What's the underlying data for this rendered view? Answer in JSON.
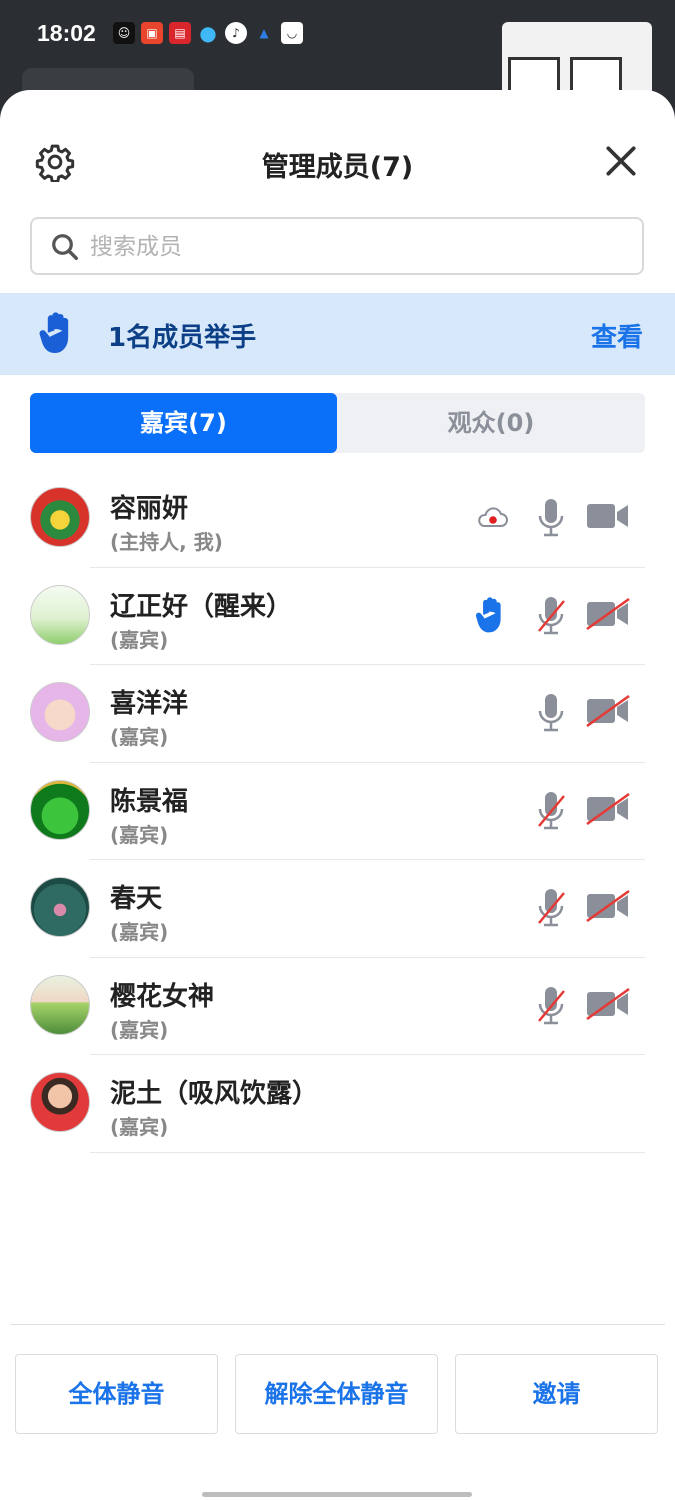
{
  "status_bar": {
    "time": "18:02"
  },
  "header": {
    "title": "管理成员(7)"
  },
  "search": {
    "placeholder": "搜索成员"
  },
  "raise_hand": {
    "text": "1名成员举手",
    "view_label": "查看"
  },
  "tabs": [
    {
      "label": "嘉宾(7)"
    },
    {
      "label": "观众(0)"
    }
  ],
  "members": [
    {
      "name": "容丽妍",
      "role": "(主持人, 我)",
      "recording": true,
      "hand_raised": false,
      "mic": "on",
      "camera": "on-gray"
    },
    {
      "name": "辽正好（醒来）",
      "role": "(嘉宾)",
      "recording": false,
      "hand_raised": true,
      "mic": "muted",
      "camera": "off"
    },
    {
      "name": "喜洋洋",
      "role": "(嘉宾)",
      "recording": false,
      "hand_raised": false,
      "mic": "on",
      "camera": "off"
    },
    {
      "name": "陈景福",
      "role": "(嘉宾)",
      "recording": false,
      "hand_raised": false,
      "mic": "muted",
      "camera": "off"
    },
    {
      "name": "春天",
      "role": "(嘉宾)",
      "recording": false,
      "hand_raised": false,
      "mic": "muted",
      "camera": "off"
    },
    {
      "name": "樱花女神",
      "role": "(嘉宾)",
      "recording": false,
      "hand_raised": false,
      "mic": "muted",
      "camera": "off"
    },
    {
      "name": "泥土（吸风饮露）",
      "role": "(嘉宾)",
      "recording": false,
      "hand_raised": false,
      "mic": "none",
      "camera": "none"
    }
  ],
  "footer": {
    "mute_all": "全体静音",
    "unmute_all": "解除全体静音",
    "invite": "邀请"
  },
  "colors": {
    "accent": "#0a6ff9",
    "raise_bar_bg": "#d6e8fa",
    "link": "#1a73e8",
    "muted_slash": "#e53935"
  }
}
